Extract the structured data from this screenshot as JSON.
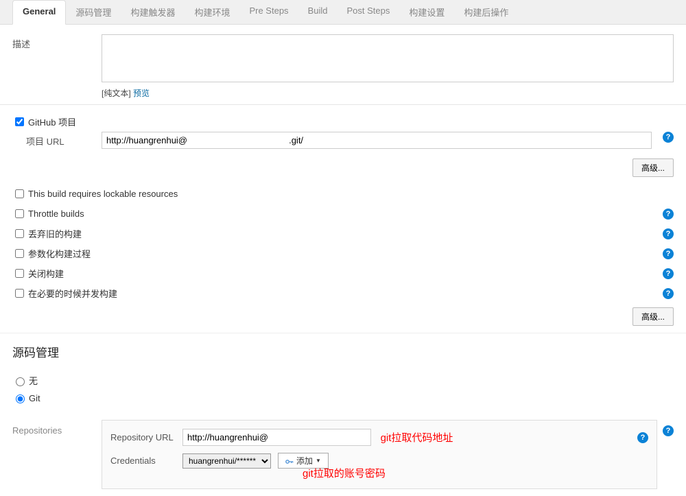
{
  "tabs": {
    "general": "General",
    "scm": "源码管理",
    "triggers": "构建触发器",
    "env": "构建环境",
    "pre": "Pre Steps",
    "build": "Build",
    "post": "Post Steps",
    "settings": "构建设置",
    "postops": "构建后操作"
  },
  "general": {
    "description_label": "描述",
    "description_value": "",
    "plain_text_label": "[纯文本]",
    "preview_label": "预览",
    "github_project_label": "GitHub 项目",
    "project_url_label": "项目 URL",
    "project_url_value": "http://huangrenhui@                                         .git/",
    "advanced_btn": "高级..."
  },
  "options": {
    "lockable": "This build requires lockable resources",
    "throttle": "Throttle builds",
    "discard": "丢弃旧的构建",
    "parameterized": "参数化构建过程",
    "disable": "关闭构建",
    "concurrent": "在必要的时候并发构建"
  },
  "scm_section": {
    "title": "源码管理",
    "none": "无",
    "git": "Git",
    "repositories_label": "Repositories",
    "repo_url_label": "Repository URL",
    "repo_url_value": "http://huangrenhui@                                        .git",
    "credentials_label": "Credentials",
    "credentials_selected": "huangrenhui/******",
    "add_btn": "添加",
    "annotation_url": "git拉取代码地址",
    "annotation_cred": "git拉取的账号密码"
  },
  "help_text": "?"
}
